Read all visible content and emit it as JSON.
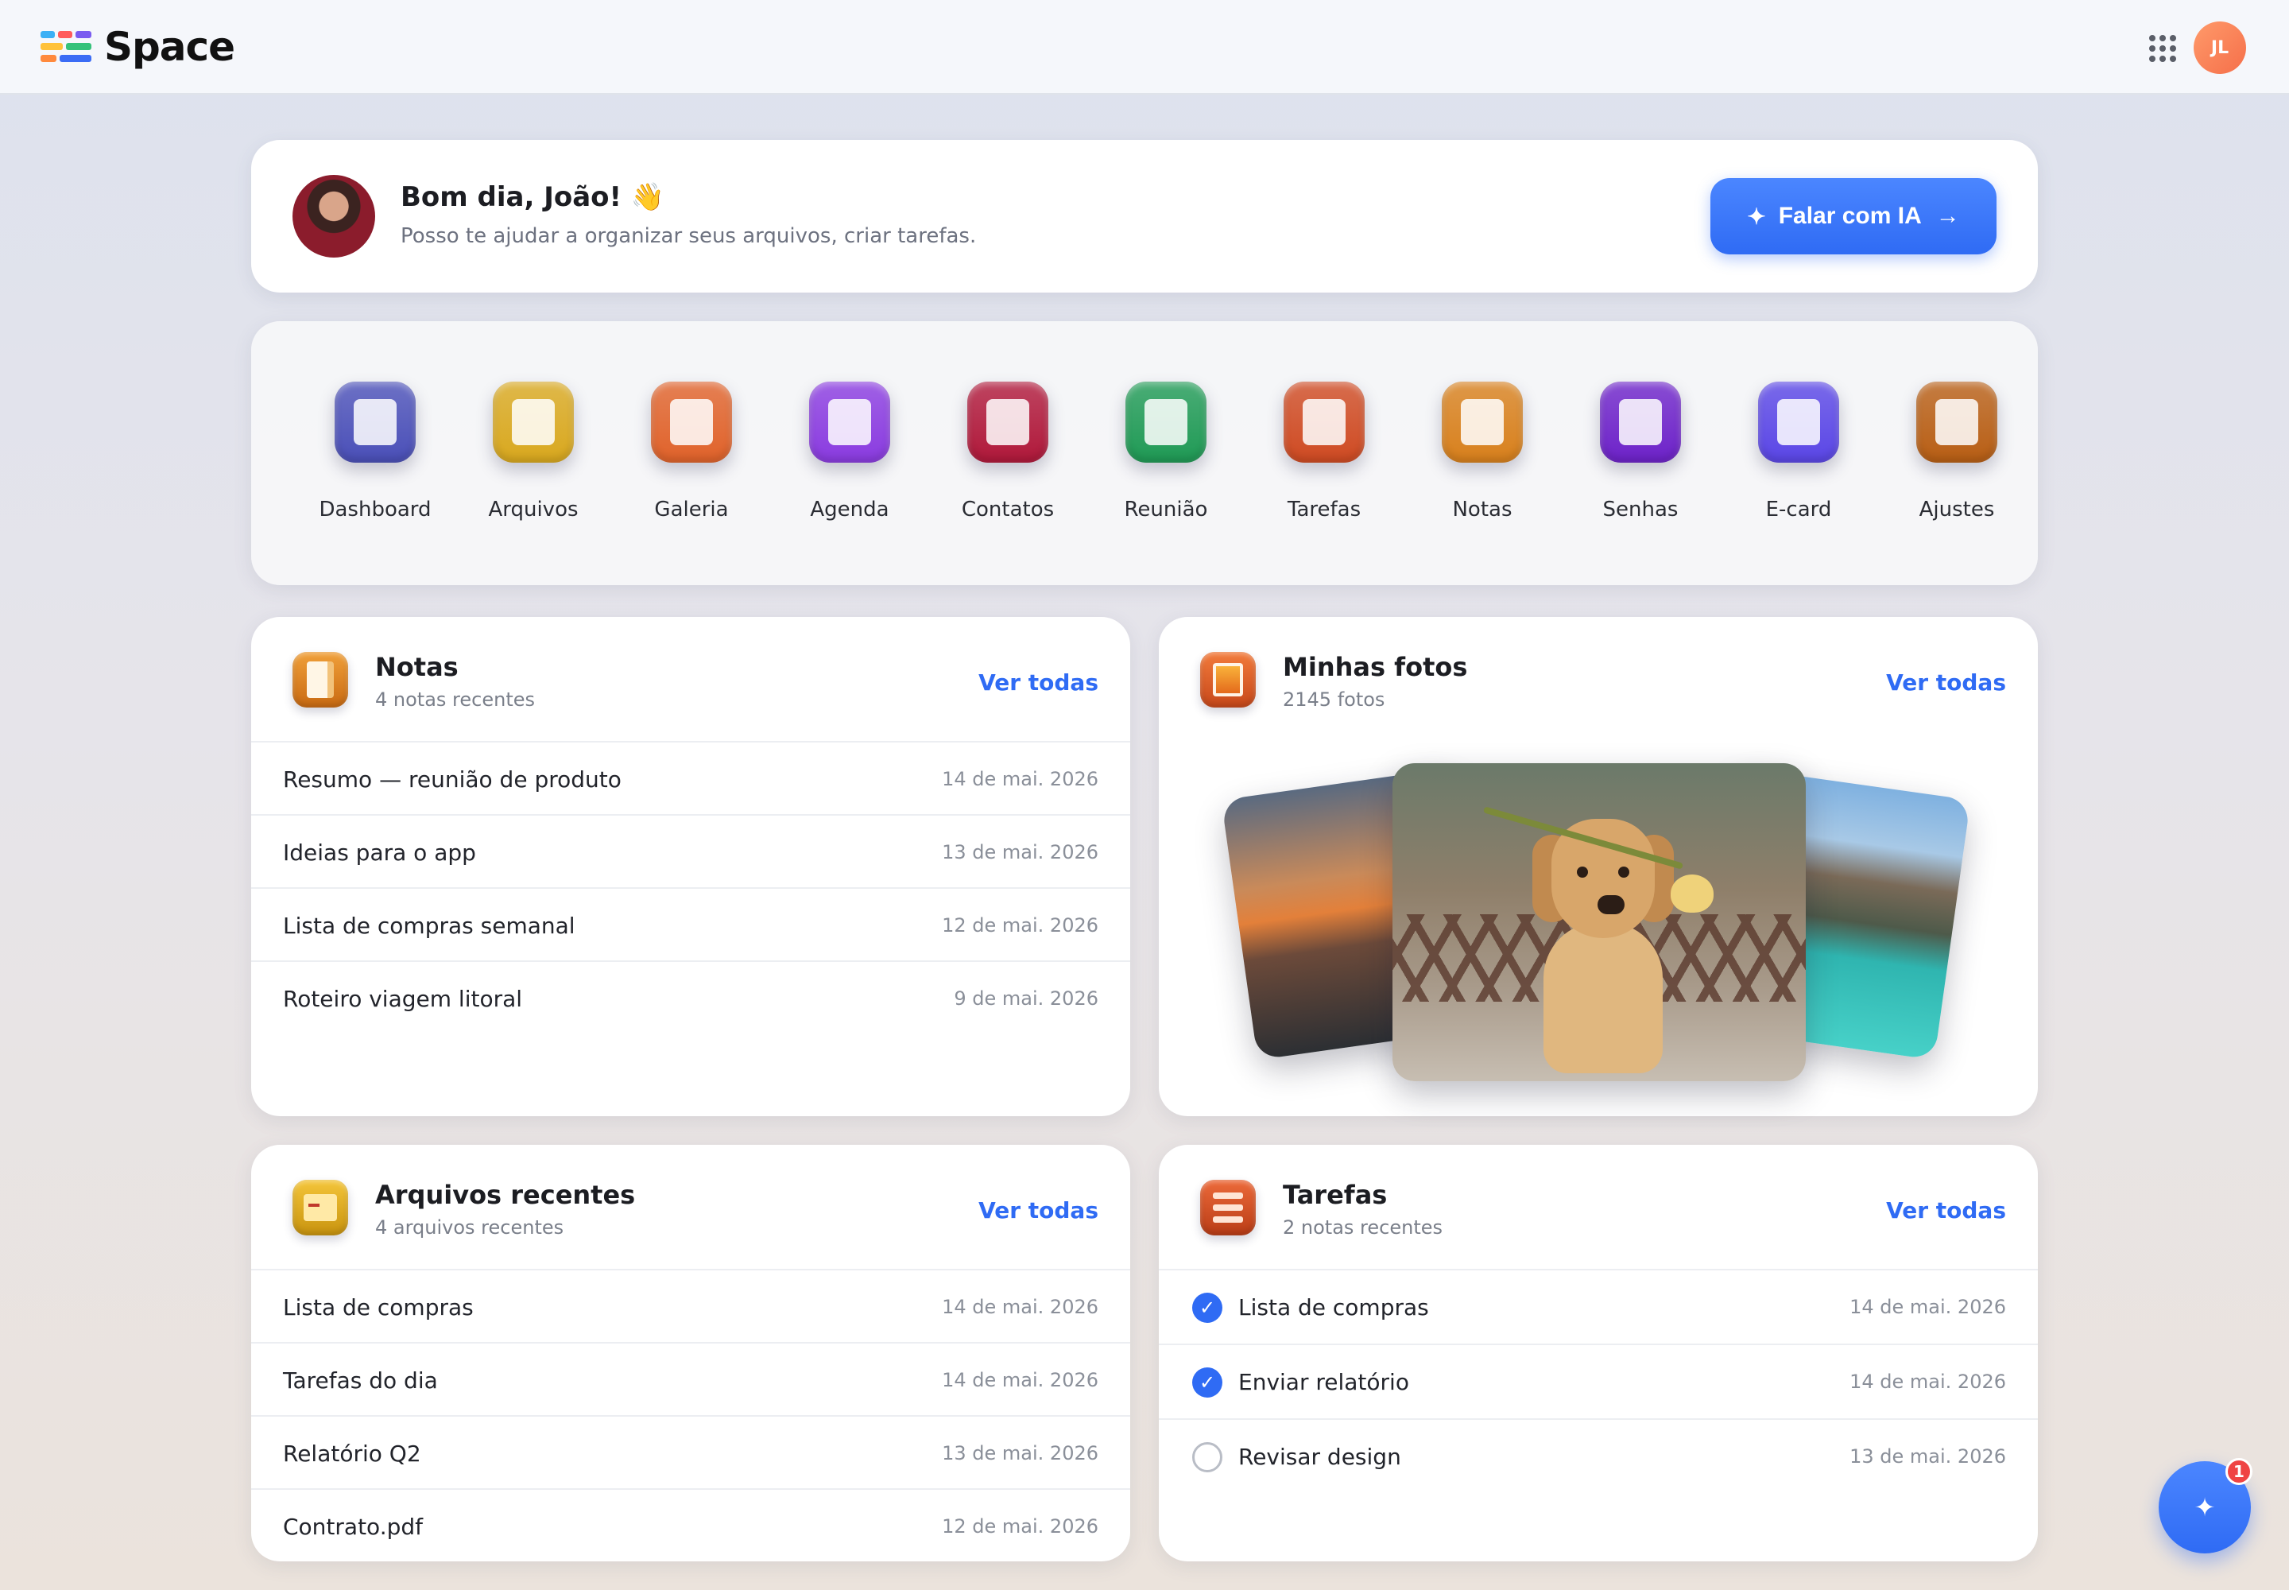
{
  "app": {
    "name": "Space"
  },
  "header": {
    "avatar_initials": "JL"
  },
  "greeting": {
    "title": "Bom dia, João! 👋",
    "subtitle": "Posso te ajudar a organizar seus arquivos, criar tarefas.",
    "ai_button": "Falar com IA"
  },
  "apps": [
    {
      "label": "Dashboard",
      "icon": "dashboard-icon",
      "color": "#4a4fb8"
    },
    {
      "label": "Arquivos",
      "icon": "folder-icon",
      "color": "#d9a81e"
    },
    {
      "label": "Galeria",
      "icon": "gallery-icon",
      "color": "#e0622a"
    },
    {
      "label": "Agenda",
      "icon": "calendar-icon",
      "color": "#8a3be0"
    },
    {
      "label": "Contatos",
      "icon": "contact-icon",
      "color": "#b0183a"
    },
    {
      "label": "Reunião",
      "icon": "meeting-icon",
      "color": "#1f9a55"
    },
    {
      "label": "Tarefas",
      "icon": "tasks-icon",
      "color": "#cf4a22"
    },
    {
      "label": "Notas",
      "icon": "notes-icon",
      "color": "#d8801c"
    },
    {
      "label": "Senhas",
      "icon": "lock-icon",
      "color": "#6d22c9"
    },
    {
      "label": "E-card",
      "icon": "ecard-icon",
      "color": "#5a46e6"
    },
    {
      "label": "Ajustes",
      "icon": "settings-toggle-icon",
      "color": "#b85e14"
    }
  ],
  "notes": {
    "title": "Notas",
    "subtitle": "4 notas recentes",
    "link": "Ver todas",
    "items": [
      {
        "title": "Resumo — reunião de produto",
        "date": "14 de mai. 2026"
      },
      {
        "title": "Ideias para o app",
        "date": "13 de mai. 2026"
      },
      {
        "title": "Lista de compras semanal",
        "date": "12 de mai. 2026"
      },
      {
        "title": "Roteiro viagem litoral",
        "date": "9 de mai. 2026"
      }
    ]
  },
  "photos": {
    "title": "Minhas fotos",
    "subtitle": "2145 fotos",
    "link": "Ver todas"
  },
  "files": {
    "title": "Arquivos recentes",
    "subtitle": "4 arquivos recentes",
    "link": "Ver todas",
    "items": [
      {
        "title": "Lista de compras",
        "date": "14 de mai. 2026"
      },
      {
        "title": "Tarefas do dia",
        "date": "14 de mai. 2026"
      },
      {
        "title": "Relatório Q2",
        "date": "13 de mai. 2026"
      },
      {
        "title": "Contrato.pdf",
        "date": "12 de mai. 2026"
      }
    ]
  },
  "tasks": {
    "title": "Tarefas",
    "subtitle": "2 notas recentes",
    "link": "Ver todas",
    "items": [
      {
        "title": "Lista de compras",
        "date": "14 de mai. 2026",
        "done": true
      },
      {
        "title": "Enviar relatório",
        "date": "14 de mai. 2026",
        "done": true
      },
      {
        "title": "Revisar design",
        "date": "13 de mai. 2026",
        "done": false
      }
    ]
  },
  "fab": {
    "badge": "1"
  }
}
